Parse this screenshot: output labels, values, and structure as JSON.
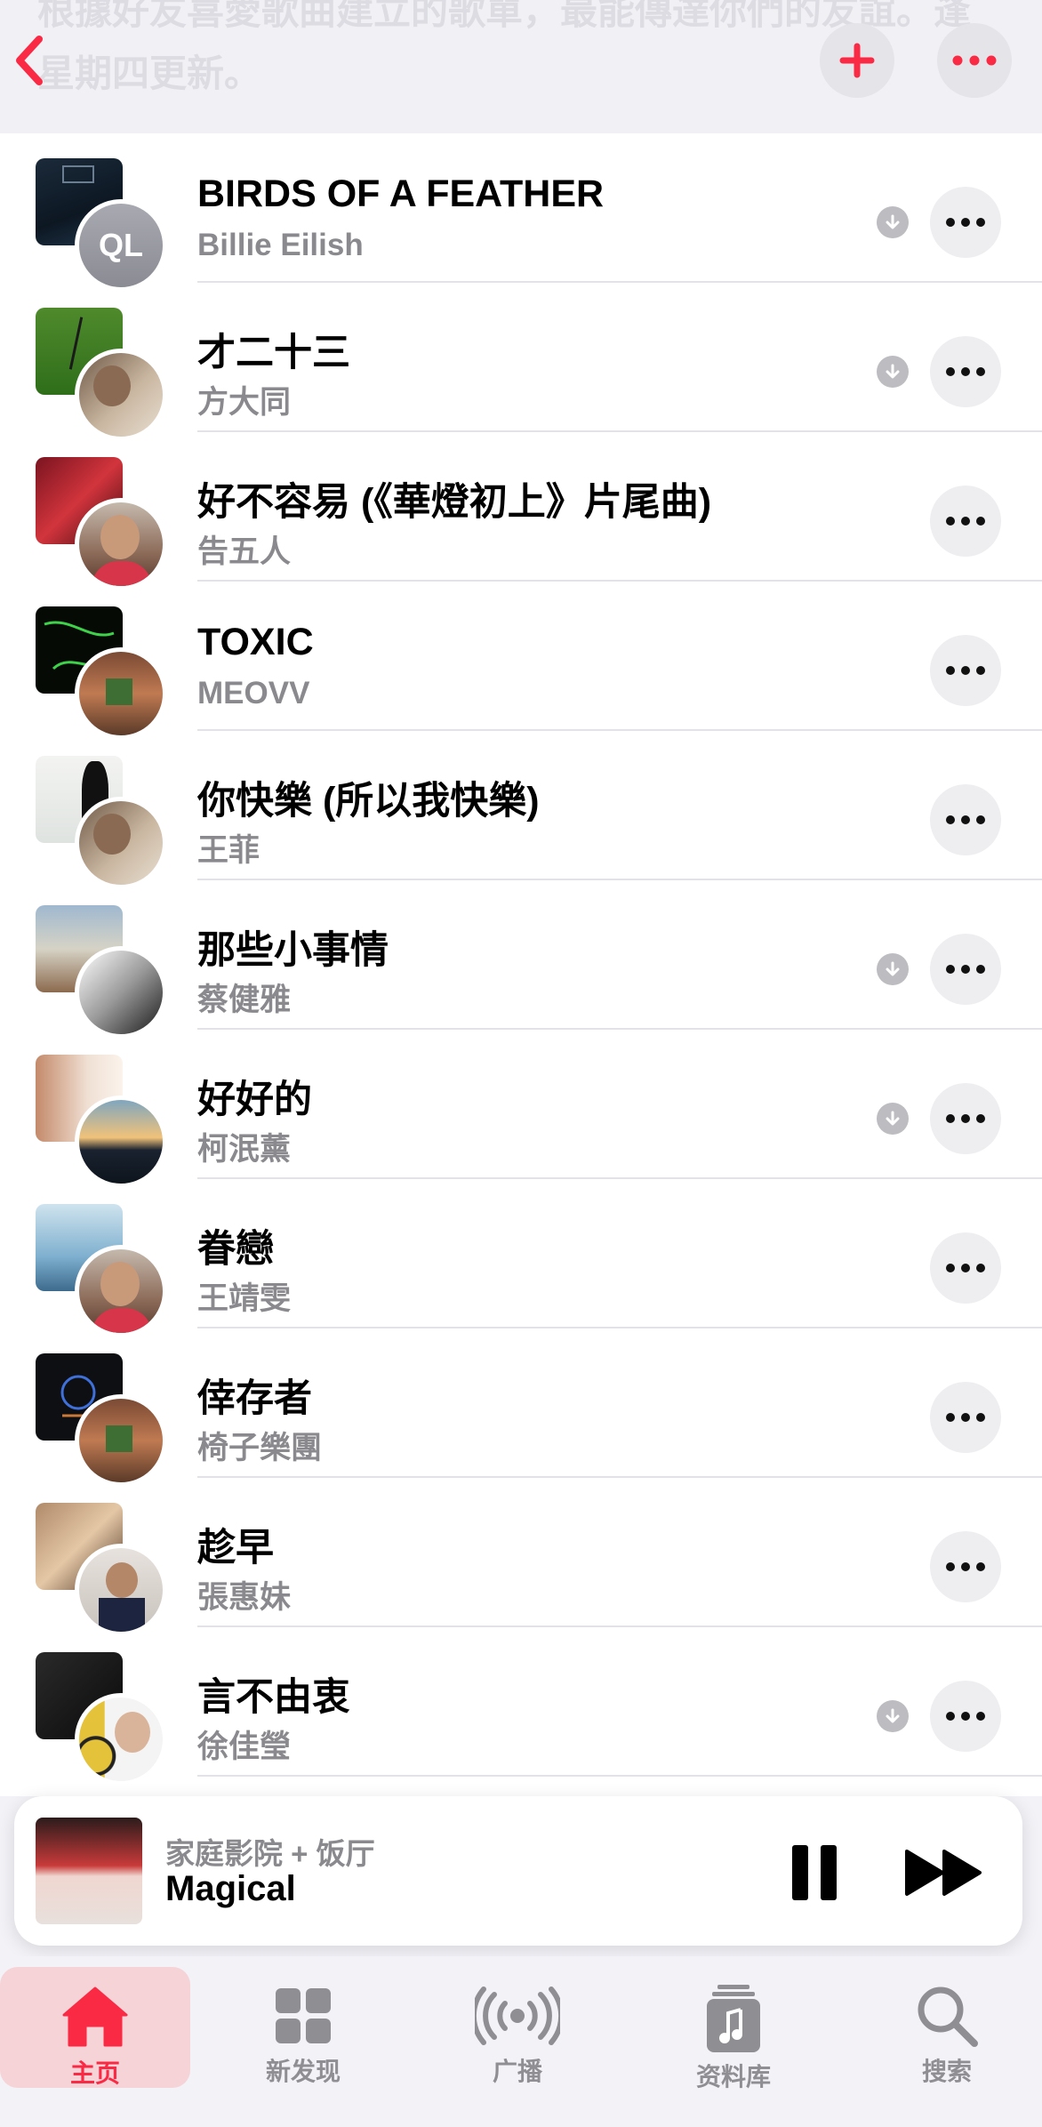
{
  "header": {
    "description": "根據好友喜愛歌曲建立的歌單，最能傳達你們的友誼。逢星期四更新。",
    "back_icon": "chevron-left-icon",
    "add_icon": "plus-icon",
    "more_icon": "ellipsis-icon",
    "accent_color": "#fa2a45"
  },
  "songs": [
    {
      "title": "BIRDS OF A FEATHER",
      "artist": "Billie Eilish",
      "downloaded": true,
      "avatar_initials": "QL"
    },
    {
      "title": "才二十三",
      "artist": "方大同",
      "downloaded": true
    },
    {
      "title": "好不容易 (《華燈初上》片尾曲)",
      "artist": "告五人",
      "downloaded": false
    },
    {
      "title": "TOXIC",
      "artist": "MEOVV",
      "downloaded": false
    },
    {
      "title": "你快樂 (所以我快樂)",
      "artist": "王菲",
      "downloaded": false
    },
    {
      "title": "那些小事情",
      "artist": "蔡健雅",
      "downloaded": true
    },
    {
      "title": "好好的",
      "artist": "柯泯薰",
      "downloaded": true
    },
    {
      "title": "眷戀",
      "artist": "王靖雯",
      "downloaded": false
    },
    {
      "title": "倖存者",
      "artist": "椅子樂團",
      "downloaded": false
    },
    {
      "title": "趁早",
      "artist": "張惠妹",
      "downloaded": false
    },
    {
      "title": "言不由衷",
      "artist": "徐佳瑩",
      "downloaded": true
    }
  ],
  "player": {
    "subtitle": "家庭影院 + 饭厅",
    "song": "Magical",
    "pause_icon": "pause-icon",
    "next_icon": "forward-icon"
  },
  "tabs": [
    {
      "label": "主页",
      "icon": "home-icon",
      "active": true
    },
    {
      "label": "新发现",
      "icon": "grid-icon",
      "active": false
    },
    {
      "label": "广播",
      "icon": "radio-icon",
      "active": false
    },
    {
      "label": "资料库",
      "icon": "library-icon",
      "active": false
    },
    {
      "label": "搜索",
      "icon": "search-icon",
      "active": false
    }
  ]
}
